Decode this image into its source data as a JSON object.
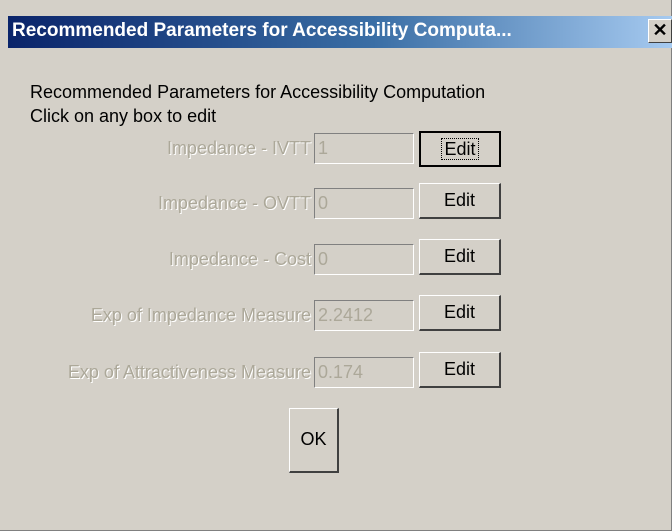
{
  "window": {
    "title": "Recommended Parameters for Accessibility Computa...",
    "close_glyph": "✕"
  },
  "header": {
    "line1": "Recommended Parameters for Accessibility Computation",
    "line2": "Click on any box to edit"
  },
  "params": [
    {
      "label": "Impedance - IVTT",
      "value": "1",
      "button": "Edit"
    },
    {
      "label": "Impedance - OVTT",
      "value": "0",
      "button": "Edit"
    },
    {
      "label": "Impedance - Cost",
      "value": "0",
      "button": "Edit"
    },
    {
      "label": "Exp of Impedance Measure",
      "value": "2.2412",
      "button": "Edit"
    },
    {
      "label": "Exp of Attractiveness Measure",
      "value": "0.174",
      "button": "Edit"
    }
  ],
  "ok_label": "OK",
  "colors": {
    "title_bar_start": "#0a246a",
    "title_bar_end": "#a6caf0",
    "window_face": "#d4d0c8",
    "disabled_text": "#aca899"
  },
  "icons": {
    "close": "close-icon"
  }
}
